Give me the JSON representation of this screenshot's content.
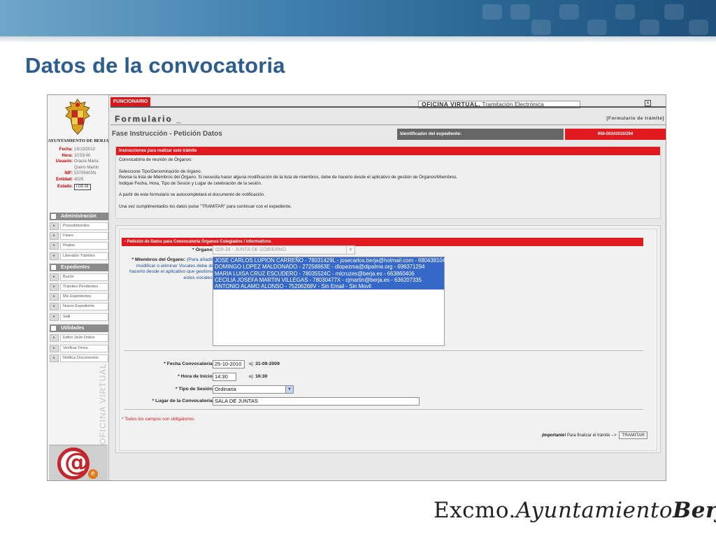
{
  "slide": {
    "title": "Datos de la convocatoria",
    "brand_part1": "Excmo.",
    "brand_part2": "Ayuntamiento",
    "brand_part3": "Berja"
  },
  "sidebar": {
    "org_name": "AYUNTAMIENTO DE BERJA",
    "meta": [
      {
        "key": "Fecha:",
        "value": "19/10/2010"
      },
      {
        "key": "Hora:",
        "value": "10:53:40"
      },
      {
        "key": "Usuario:",
        "value": "Gracia María Quero Martín"
      },
      {
        "key": "NIF:",
        "value": "53705403N"
      },
      {
        "key": "Entidad:",
        "value": "4029"
      }
    ],
    "estado_label": "Estado:",
    "estado_value": "LOG 69",
    "sections": [
      {
        "label": "Administración",
        "items": [
          "Procedimientos",
          "Fases",
          "Reglas",
          "Liberador Trámites"
        ]
      },
      {
        "label": "Expedientes",
        "items": [
          "Buzón",
          "Trámites Pendientes",
          "Mis Expedientes",
          "Nuevo Expediente",
          "Salir"
        ]
      },
      {
        "label": "Utilidades",
        "items": [
          "Editor JaVe Online",
          "Verificar Firma",
          "Notifica Documentos"
        ]
      }
    ],
    "vertical_text": "OFICINA VIRTUAL"
  },
  "app": {
    "role_badge": "FUNCIONARIO",
    "office_tab_bold": "OFICINA VIRTUAL.",
    "office_tab_rest": " Tramitación Electrónica",
    "close_label": "x",
    "form_title": "Formulario _",
    "form_title_right": "[Formulario de trámite]",
    "phase": "Fase Instrucción - Petición Datos",
    "id_label": "Identificador del expediente:",
    "id_value": "950-002#2010/294"
  },
  "instructions": {
    "header": "Instrucciones para realizar este trámite",
    "line1": "Convocatoria de reunión de Órganos:",
    "line2": "Seleccione Tipo/Denominación de órgano.",
    "line3": "Revise la lista de Miembros del Órgano. Si necesita hacer alguna modificación de la lista de miembros, debe de hacerlo desde el aplicativo de gestión de Órganos/Miembros.",
    "line4": "Indique Fecha, Hora, Tipo de Sesión y Lugar de celebración de la sesión.",
    "line5": "A partir de este formulario se autocompletará el documento de notificación.",
    "line6": "Una vez cumplimentados los datos pulse \"TRAMITAR\" para continuar con el expediente."
  },
  "form": {
    "header": "- Petición de Datos para Convocatoria Órganos Colegiados / Informativos",
    "organo_label": "* Órgano:",
    "organo_value": "029-34 - JUNTA DE GOBIERNO",
    "members_label": "* Miembros del Órgano:",
    "members_hint": "(Para añadir, modificar o eliminar Vocales debe de hacerlo desde el aplicativo que gestiona estos vocales)",
    "members": [
      "JOSE CARLOS LUPION CARREÑO - 78031429L - josecarlos.berja@hotmail.com - 680438104",
      "DOMINGO LOPEZ MALDONADO - 27258863E - dlopezma@dipalme.org - 696371294",
      "MARIA LUISA CRUZ ESCUDERO - 78035524C - mlcruzes@berja.es - 663860406",
      "CECILIA JOSEFA MARTIN VILLEGAS - 78030477X - cjmartin@berja.es - 636207335",
      "ANTONIO ALAMO ALONSO - 75206268V - Sin Email - Sin Movil"
    ],
    "fecha_label": "* Fecha Convocatoria:",
    "fecha_value": "25-10-2010",
    "fecha_hint_prefix": "ej:",
    "fecha_hint": "31-09-2009",
    "hora_label": "* Hora de Inicio:",
    "hora_value": "14:30",
    "hora_hint_prefix": "ej:",
    "hora_hint": "16:30",
    "sesion_label": "* Tipo de Sesión:",
    "sesion_value": "Ordinaria",
    "lugar_label": "* Lugar de la Convocatoria:",
    "lugar_value": "SALA DE JUNTAS",
    "required_note": "* Todos los campos son obligatorios",
    "important_bold": "¡Importante!",
    "important_text": "Para finalizar el trámite -->",
    "tramitar_label": "TRAMITAR"
  }
}
